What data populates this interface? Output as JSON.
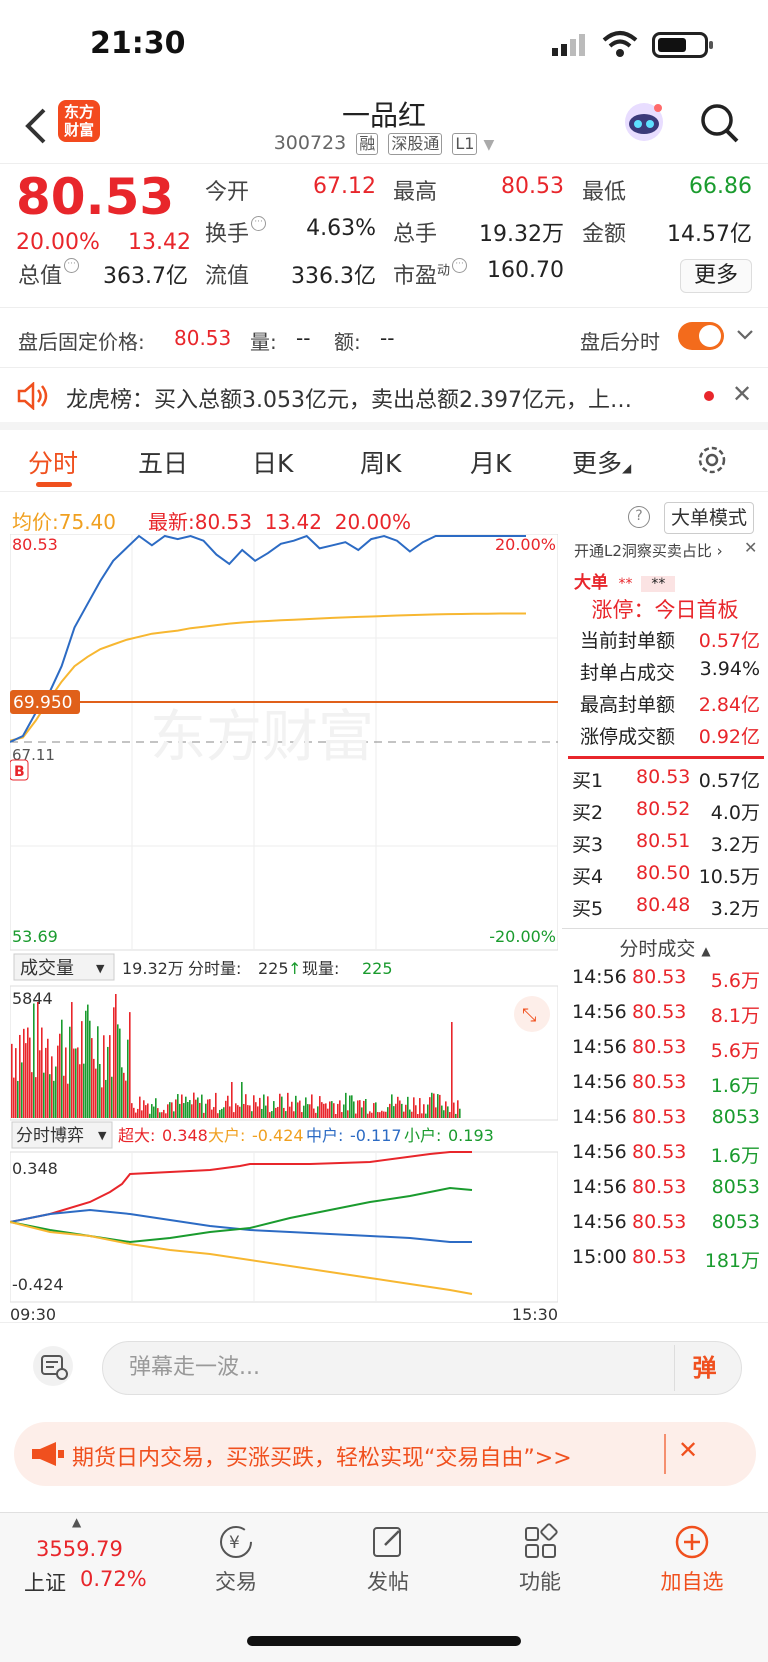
{
  "status": {
    "time": "21:30"
  },
  "header": {
    "title": "一品红",
    "code": "300723",
    "tags": [
      "融",
      "深股通",
      "L1"
    ],
    "logo": "东方财富"
  },
  "quote": {
    "price": "80.53",
    "pct": "20.00%",
    "change": "13.42",
    "open_label": "今开",
    "open": "67.12",
    "high_label": "最高",
    "high": "80.53",
    "low_label": "最低",
    "low": "66.86",
    "turnover_label": "换手",
    "turnover": "4.63%",
    "volume_label": "总手",
    "volume": "19.32万",
    "amount_label": "金额",
    "amount": "14.57亿",
    "mktcap_label": "总值",
    "mktcap": "363.7亿",
    "float_label": "流值",
    "float": "336.3亿",
    "pe_label": "市盈",
    "pe_sup": "动",
    "pe": "160.70",
    "more": "更多"
  },
  "afterhours": {
    "label": "盘后固定价格:",
    "price": "80.53",
    "vol_label": "量:",
    "vol": "--",
    "amt_label": "额:",
    "amt": "--",
    "toggle_label": "盘后分时"
  },
  "lhb": {
    "text": "龙虎榜：买入总额3.053亿元，卖出总额2.397亿元，上…"
  },
  "tabs": [
    "分时",
    "五日",
    "日K",
    "周K",
    "月K",
    "更多"
  ],
  "info": {
    "avg_label": "均价:",
    "avg": "75.40",
    "last_label": "最新:",
    "last": "80.53",
    "chg": "13.42",
    "pct": "20.00%",
    "mode": "大单模式"
  },
  "chart": {
    "price_top": "80.53",
    "price_bottom": "53.69",
    "pct_top": "20.00%",
    "pct_bottom": "-20.00%",
    "ref_price": "69.950",
    "prev_close": "67.11",
    "buy_marker": "B",
    "watermark": "东方财富",
    "vol_selector": "成交量",
    "vol_total": "19.32万",
    "vol_period_label": "分时量:",
    "vol_period": "225",
    "vol_now_label": "现量:",
    "vol_now": "225",
    "vol_max": "5844",
    "flow_selector": "分时博弈",
    "flow_super_label": "超大:",
    "flow_super": "0.348",
    "flow_big_label": "大户:",
    "flow_big": "-0.424",
    "flow_mid_label": "中户:",
    "flow_mid": "-0.117",
    "flow_small_label": "小户:",
    "flow_small": "0.193",
    "flow_top": "0.348",
    "flow_bottom": "-0.424",
    "time_start": "09:30",
    "time_end": "15:30"
  },
  "chart_data": {
    "type": "line",
    "x_range": [
      "09:30",
      "15:00"
    ],
    "ylim": [
      53.69,
      80.53
    ],
    "series": [
      {
        "values": [
          67.11,
          67.5,
          69.0,
          70.2,
          72.0,
          74.5,
          76.0,
          77.5,
          78.8,
          79.6,
          80.53,
          79.8,
          80.53,
          80.2,
          80.53,
          80.1,
          79.2,
          78.6,
          79.5,
          78.8,
          79.3,
          79.9,
          80.1,
          80.53,
          79.6,
          79.8,
          80.0,
          79.5,
          80.2,
          80.53,
          80.1,
          79.4,
          80.0,
          80.53,
          80.53,
          80.53,
          80.53,
          80.53,
          80.53,
          80.53,
          80.53
        ]
      },
      {
        "values": [
          67.2,
          67.4,
          68.5,
          69.8,
          71.0,
          72.0,
          72.6,
          73.1,
          73.4,
          73.7,
          73.9,
          74.1,
          74.2,
          74.3,
          74.45,
          74.55,
          74.65,
          74.75,
          74.82,
          74.88,
          74.92,
          74.96,
          75.0,
          75.04,
          75.08,
          75.12,
          75.15,
          75.18,
          75.21,
          75.24,
          75.27,
          75.3,
          75.32,
          75.34,
          75.36,
          75.37,
          75.38,
          75.39,
          75.4,
          75.4,
          75.4
        ]
      }
    ]
  },
  "panel": {
    "title": "开通L2洞察买卖占比",
    "big_label": "大单",
    "limit_title": "涨停：今日首板",
    "rows": [
      {
        "label": "当前封单额",
        "value": "0.57亿"
      },
      {
        "label": "封单占成交",
        "value": "3.94%"
      },
      {
        "label": "最高封单额",
        "value": "2.84亿"
      },
      {
        "label": "涨停成交额",
        "value": "0.92亿"
      }
    ],
    "book": [
      {
        "label": "买1",
        "price": "80.53",
        "vol": "0.57亿"
      },
      {
        "label": "买2",
        "price": "80.52",
        "vol": "4.0万"
      },
      {
        "label": "买3",
        "price": "80.51",
        "vol": "3.2万"
      },
      {
        "label": "买4",
        "price": "80.50",
        "vol": "10.5万"
      },
      {
        "label": "买5",
        "price": "80.48",
        "vol": "3.2万"
      }
    ],
    "trades_title": "分时成交",
    "trades": [
      {
        "t": "14:56",
        "p": "80.53",
        "v": "5.6万"
      },
      {
        "t": "14:56",
        "p": "80.53",
        "v": "8.1万"
      },
      {
        "t": "14:56",
        "p": "80.53",
        "v": "5.6万"
      },
      {
        "t": "14:56",
        "p": "80.53",
        "v": "1.6万"
      },
      {
        "t": "14:56",
        "p": "80.53",
        "v": "8053"
      },
      {
        "t": "14:56",
        "p": "80.53",
        "v": "1.6万"
      },
      {
        "t": "14:56",
        "p": "80.53",
        "v": "8053"
      },
      {
        "t": "14:56",
        "p": "80.53",
        "v": "8053"
      },
      {
        "t": "15:00",
        "p": "80.53",
        "v": "181万"
      }
    ]
  },
  "input": {
    "placeholder": "弹幕走一波...",
    "danmu": "弹"
  },
  "ad": {
    "text": "期货日内交易，买涨买跌，轻松实现“交易自由”>>"
  },
  "tabbar": {
    "index_value": "3559.79",
    "index_name": "上证",
    "index_pct": "0.72%",
    "items": [
      "交易",
      "发帖",
      "功能",
      "加自选"
    ]
  },
  "colors": {
    "red": "#e8262b",
    "green": "#1a9b2e",
    "orange": "#f0501e",
    "price_line": "#2c6bc4",
    "avg_line": "#f7b731"
  }
}
